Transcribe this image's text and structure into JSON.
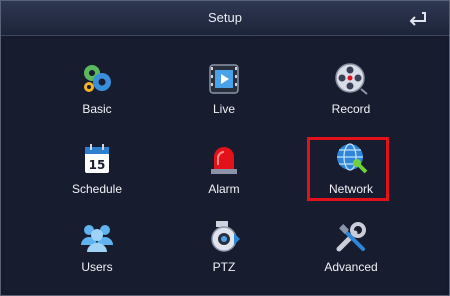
{
  "header": {
    "title": "Setup",
    "back_icon": "return-arrow-icon"
  },
  "menu": {
    "items": [
      {
        "label": "Basic",
        "icon": "gears-icon"
      },
      {
        "label": "Live",
        "icon": "film-play-icon"
      },
      {
        "label": "Record",
        "icon": "film-reel-icon"
      },
      {
        "label": "Schedule",
        "icon": "calendar-icon"
      },
      {
        "label": "Alarm",
        "icon": "siren-icon"
      },
      {
        "label": "Network",
        "icon": "globe-icon"
      },
      {
        "label": "Users",
        "icon": "users-icon"
      },
      {
        "label": "PTZ",
        "icon": "ptz-camera-icon"
      },
      {
        "label": "Advanced",
        "icon": "wrench-screwdriver-icon"
      }
    ],
    "calendar_day": "15",
    "highlighted": "Network"
  },
  "colors": {
    "highlight": "#e3111a",
    "background": "#181c2f",
    "titlebar": "#2e3852"
  }
}
